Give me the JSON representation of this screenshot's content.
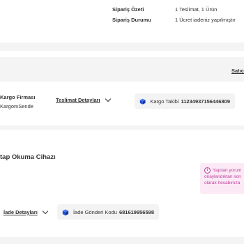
{
  "summary": {
    "order_summary_label": "Sipariş Özeti",
    "order_summary_value": "1 Teslimat, 1 Ürün",
    "order_status_label": "Sipariş Durumu",
    "order_status_value": "1 Ücret iadeniz yapılmıştır"
  },
  "seller": {
    "link_label": "Satıcı"
  },
  "shipment": {
    "carrier_label": "Kargo Firması",
    "carrier_value": "KargomSende",
    "details_link": "Teslimat Detayları",
    "tracking_label": "Kargo Takibi",
    "tracking_number": "11234937156446809"
  },
  "product": {
    "name": "tap Okuma Cihazı"
  },
  "note": {
    "line1": "Yapılan yorum",
    "line2": "onaylandıktan son",
    "line3": "olarak hesabınıza"
  },
  "return": {
    "details_link": "İade Detayları",
    "code_label": "İade Gönderi Kodu",
    "code_value": "681619956598"
  },
  "colors": {
    "accent": "#c0409d",
    "icon_blue": "#1e4fd8",
    "band": "#f4f4f4"
  }
}
